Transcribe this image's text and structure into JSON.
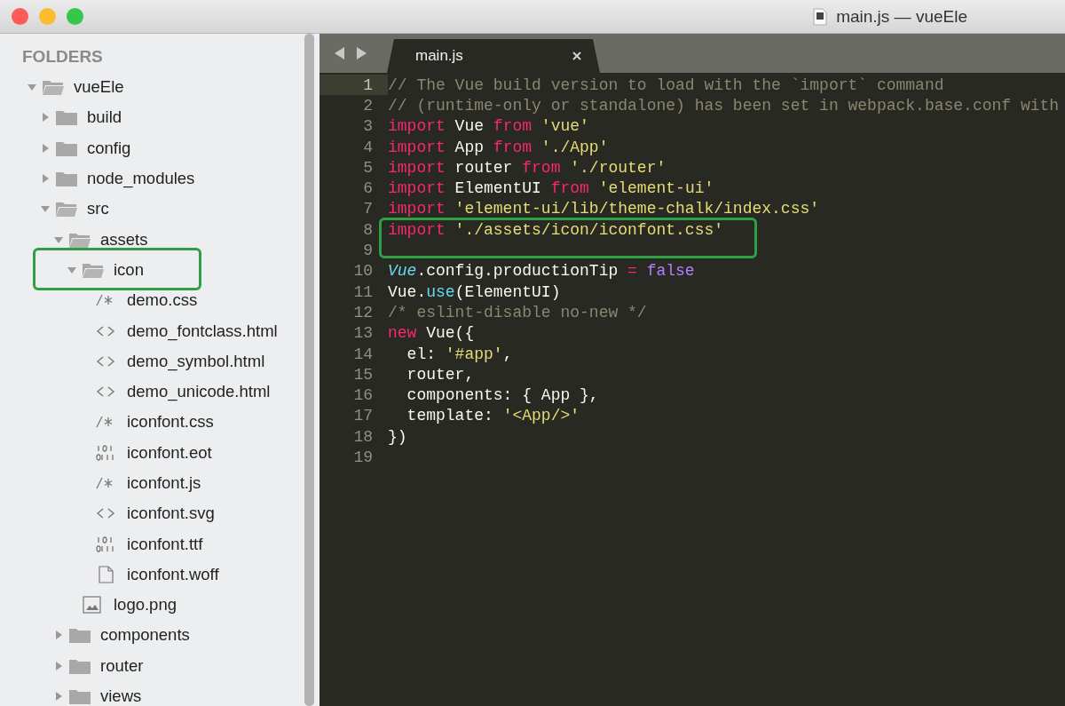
{
  "window": {
    "title": "main.js — vueEle"
  },
  "sidebar": {
    "heading": "FOLDERS",
    "tree": [
      {
        "name": "vueEle",
        "kind": "folder",
        "expanded": true,
        "annotated": false,
        "children": [
          {
            "name": "build",
            "kind": "folder",
            "expanded": false,
            "annotated": false
          },
          {
            "name": "config",
            "kind": "folder",
            "expanded": false,
            "annotated": false
          },
          {
            "name": "node_modules",
            "kind": "folder",
            "expanded": false,
            "annotated": false
          },
          {
            "name": "src",
            "kind": "folder",
            "expanded": true,
            "annotated": false,
            "children": [
              {
                "name": "assets",
                "kind": "folder",
                "expanded": true,
                "annotated": false,
                "children": [
                  {
                    "name": "icon",
                    "kind": "folder",
                    "expanded": true,
                    "annotated": true,
                    "children": [
                      {
                        "name": "demo.css",
                        "kind": "style",
                        "annotated": false
                      },
                      {
                        "name": "demo_fontclass.html",
                        "kind": "markup",
                        "annotated": false
                      },
                      {
                        "name": "demo_symbol.html",
                        "kind": "markup",
                        "annotated": false
                      },
                      {
                        "name": "demo_unicode.html",
                        "kind": "markup",
                        "annotated": false
                      },
                      {
                        "name": "iconfont.css",
                        "kind": "style",
                        "annotated": false
                      },
                      {
                        "name": "iconfont.eot",
                        "kind": "binary",
                        "annotated": false
                      },
                      {
                        "name": "iconfont.js",
                        "kind": "style",
                        "annotated": false
                      },
                      {
                        "name": "iconfont.svg",
                        "kind": "markup",
                        "annotated": false
                      },
                      {
                        "name": "iconfont.ttf",
                        "kind": "binary",
                        "annotated": false
                      },
                      {
                        "name": "iconfont.woff",
                        "kind": "document",
                        "annotated": false
                      }
                    ]
                  },
                  {
                    "name": "logo.png",
                    "kind": "image",
                    "annotated": false
                  }
                ]
              },
              {
                "name": "components",
                "kind": "folder",
                "expanded": false,
                "annotated": false
              },
              {
                "name": "router",
                "kind": "folder",
                "expanded": false,
                "annotated": false
              },
              {
                "name": "views",
                "kind": "folder",
                "expanded": false,
                "annotated": false
              }
            ]
          }
        ]
      }
    ]
  },
  "tabs": [
    {
      "label": "main.js",
      "selected": true
    }
  ],
  "editor": {
    "lines": [
      {
        "number": "1",
        "current": true,
        "annotated": false,
        "tokens": [
          {
            "t": "// The Vue build version to load with the `import` command",
            "kind": "comment"
          }
        ]
      },
      {
        "number": "2",
        "current": false,
        "annotated": false,
        "tokens": [
          {
            "t": "// (runtime-only or standalone) has been set in webpack.base.conf with",
            "kind": "comment"
          }
        ]
      },
      {
        "number": "3",
        "current": false,
        "annotated": false,
        "tokens": [
          {
            "t": "import",
            "kind": "keyword"
          },
          {
            "t": " Vue ",
            "kind": "plain"
          },
          {
            "t": "from",
            "kind": "keyword"
          },
          {
            "t": " 'vue'",
            "kind": "string"
          }
        ]
      },
      {
        "number": "4",
        "current": false,
        "annotated": false,
        "tokens": [
          {
            "t": "import",
            "kind": "keyword"
          },
          {
            "t": " App ",
            "kind": "plain"
          },
          {
            "t": "from",
            "kind": "keyword"
          },
          {
            "t": " './App'",
            "kind": "string"
          }
        ]
      },
      {
        "number": "5",
        "current": false,
        "annotated": false,
        "tokens": [
          {
            "t": "import",
            "kind": "keyword"
          },
          {
            "t": " router ",
            "kind": "plain"
          },
          {
            "t": "from",
            "kind": "keyword"
          },
          {
            "t": " './router'",
            "kind": "string"
          }
        ]
      },
      {
        "number": "6",
        "current": false,
        "annotated": false,
        "tokens": [
          {
            "t": "import",
            "kind": "keyword"
          },
          {
            "t": " ElementUI ",
            "kind": "plain"
          },
          {
            "t": "from",
            "kind": "keyword"
          },
          {
            "t": " 'element-ui'",
            "kind": "string"
          }
        ]
      },
      {
        "number": "7",
        "current": false,
        "annotated": false,
        "tokens": [
          {
            "t": "import",
            "kind": "keyword"
          },
          {
            "t": " 'element-ui/lib/theme-chalk/index.css'",
            "kind": "string"
          }
        ]
      },
      {
        "number": "8",
        "current": false,
        "annotated": true,
        "tokens": [
          {
            "t": "import",
            "kind": "keyword"
          },
          {
            "t": " './assets/icon/iconfont.css'",
            "kind": "string"
          }
        ]
      },
      {
        "number": "9",
        "current": false,
        "annotated": false
      },
      {
        "number": "10",
        "current": false,
        "annotated": false,
        "tokens": [
          {
            "t": "Vue",
            "kind": "type"
          },
          {
            "t": ".config.productionTip ",
            "kind": "plain"
          },
          {
            "t": "=",
            "kind": "keyword"
          },
          {
            "t": " false",
            "kind": "constant"
          }
        ]
      },
      {
        "number": "11",
        "current": false,
        "annotated": false,
        "tokens": [
          {
            "t": "Vue.",
            "kind": "plain"
          },
          {
            "t": "use",
            "kind": "function"
          },
          {
            "t": "(ElementUI)",
            "kind": "plain"
          }
        ]
      },
      {
        "number": "12",
        "current": false,
        "annotated": false,
        "tokens": [
          {
            "t": "/* eslint-disable no-new */",
            "kind": "comment"
          }
        ]
      },
      {
        "number": "13",
        "current": false,
        "annotated": false,
        "tokens": [
          {
            "t": "new",
            "kind": "keyword"
          },
          {
            "t": " Vue({",
            "kind": "plain"
          }
        ]
      },
      {
        "number": "14",
        "current": false,
        "annotated": false,
        "tokens": [
          {
            "t": "  el: ",
            "kind": "plain"
          },
          {
            "t": "'#app'",
            "kind": "string"
          },
          {
            "t": ",",
            "kind": "plain"
          }
        ]
      },
      {
        "number": "15",
        "current": false,
        "annotated": false,
        "tokens": [
          {
            "t": "  router,",
            "kind": "plain"
          }
        ]
      },
      {
        "number": "16",
        "current": false,
        "annotated": false,
        "tokens": [
          {
            "t": "  components: { App },",
            "kind": "plain"
          }
        ]
      },
      {
        "number": "17",
        "current": false,
        "annotated": false,
        "tokens": [
          {
            "t": "  template: ",
            "kind": "plain"
          },
          {
            "t": "'<App/>'",
            "kind": "string"
          }
        ]
      },
      {
        "number": "18",
        "current": false,
        "annotated": false,
        "tokens": [
          {
            "t": "})",
            "kind": "plain"
          }
        ]
      },
      {
        "number": "19",
        "current": false,
        "annotated": false
      }
    ]
  }
}
